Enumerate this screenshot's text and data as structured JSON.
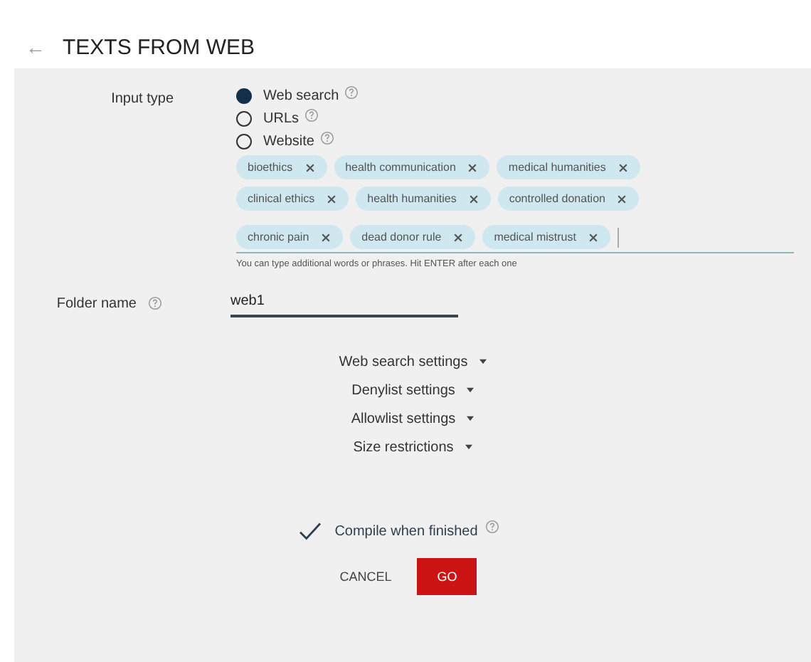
{
  "header": {
    "back_icon": "←",
    "title": "TEXTS FROM WEB"
  },
  "input_type": {
    "label": "Input type",
    "options": [
      {
        "label": "Web search",
        "selected": true
      },
      {
        "label": "URLs",
        "selected": false
      },
      {
        "label": "Website",
        "selected": false
      }
    ]
  },
  "keyword_rows": [
    [
      "bioethics",
      "health communication",
      "medical humanities"
    ],
    [
      "clinical ethics",
      "health humanities",
      "controlled donation"
    ],
    [
      "chronic pain",
      "dead donor rule",
      "medical mistrust"
    ]
  ],
  "keyword_hint": "You can type additional words or phrases. Hit ENTER after each one",
  "folder": {
    "label": "Folder name",
    "value": "web1"
  },
  "sections": [
    "Web search settings",
    "Denylist settings",
    "Allowlist settings",
    "Size restrictions"
  ],
  "compile": {
    "label": "Compile when finished",
    "checked": true
  },
  "buttons": {
    "cancel": "CANCEL",
    "go": "GO"
  }
}
